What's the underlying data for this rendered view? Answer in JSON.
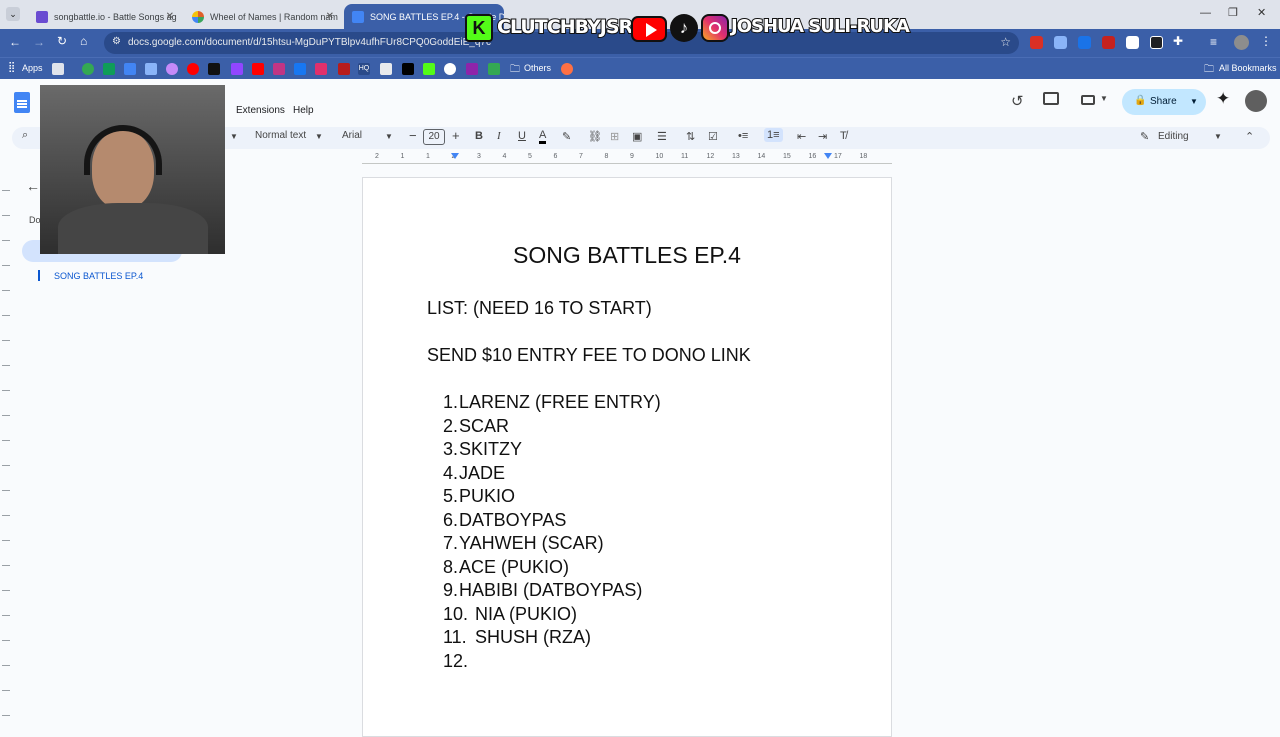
{
  "tabs": [
    {
      "title": "songbattle.io - Battle Songs ag",
      "color": "#6a4cd1"
    },
    {
      "title": "Wheel of Names | Random nam",
      "color": "#e0602a"
    },
    {
      "title": "SONG BATTLES EP.4 - Google Do",
      "color": "#4285f4",
      "active": true
    }
  ],
  "address": {
    "url": "docs.google.com/document/d/15htsu-MgDuPYTBlpv4ufhFUr8CPQ0GoddEiE_q7c"
  },
  "bookmarks": {
    "apps_label": "Apps",
    "others_label": "Others",
    "all_label": "All Bookmarks"
  },
  "banner": {
    "handle1": "CLUTCHBYJSR",
    "handle2": "JOSHUA SULI-RUKA"
  },
  "menu": {
    "extensions": "Extensions",
    "help": "Help"
  },
  "header": {
    "share_label": "Share"
  },
  "format": {
    "style": "Normal text",
    "font": "Arial",
    "size": "20",
    "mode": "Editing"
  },
  "outline": {
    "heading": "SONG BATTLES EP.4",
    "doc_label": "Do"
  },
  "ruler": {
    "ticks": [
      "2",
      "1",
      "1",
      "2",
      "3",
      "4",
      "5",
      "6",
      "7",
      "8",
      "9",
      "10",
      "11",
      "12",
      "13",
      "14",
      "15",
      "16",
      "17",
      "18"
    ]
  },
  "document": {
    "title": "SONG BATTLES EP.4",
    "line1": "LIST: (NEED 16 TO START)",
    "line2": "SEND $10 ENTRY FEE TO DONO LINK",
    "entries": [
      {
        "num": "1.",
        "name": "LARENZ (FREE ENTRY)"
      },
      {
        "num": "2.",
        "name": "SCAR"
      },
      {
        "num": "3.",
        "name": "SKITZY"
      },
      {
        "num": "4.",
        "name": "JADE"
      },
      {
        "num": "5.",
        "name": "PUKIO"
      },
      {
        "num": "6.",
        "name": "DATBOYPAS"
      },
      {
        "num": "7.",
        "name": "YAHWEH (SCAR)"
      },
      {
        "num": "8.",
        "name": "ACE (PUKIO)"
      },
      {
        "num": "9.",
        "name": "HABIBI (DATBOYPAS)"
      },
      {
        "num": "10.",
        "name": "NIA (PUKIO)"
      },
      {
        "num": "11.",
        "name": "SHUSH (RZA)"
      },
      {
        "num": "12.",
        "name": ""
      }
    ]
  },
  "colors": {
    "accent": "#0b57d0",
    "chrome": "#3b5fa8",
    "share_bg": "#c2e7ff"
  }
}
